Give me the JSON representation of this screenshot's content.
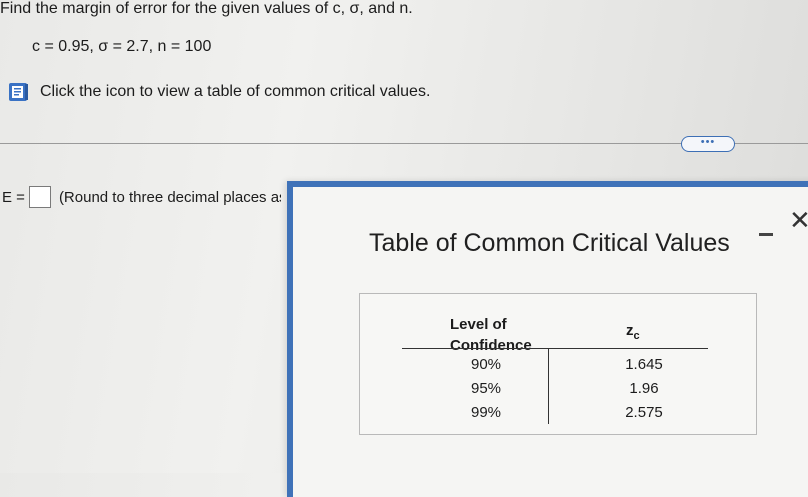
{
  "question": {
    "prompt": "Find the margin of error for the given values of c, σ, and n.",
    "params": "c = 0.95, σ = 2.7, n = 100",
    "hint": "Click the icon to view a table of common critical values.",
    "icon": "book-icon"
  },
  "toolbar": {
    "more_label": "•••"
  },
  "answer": {
    "label": "E =",
    "value": "",
    "instruction": "(Round to three decimal places as needed.)"
  },
  "modal": {
    "title": "Table of Common Critical Values",
    "minimize_label": "—",
    "close_label": "✕",
    "table": {
      "headers": [
        "Level of Confidence",
        "zc"
      ],
      "rows": [
        [
          "90%",
          "1.645"
        ],
        [
          "95%",
          "1.96"
        ],
        [
          "99%",
          "2.575"
        ]
      ]
    }
  },
  "colors": {
    "accent": "#3f72b8"
  }
}
